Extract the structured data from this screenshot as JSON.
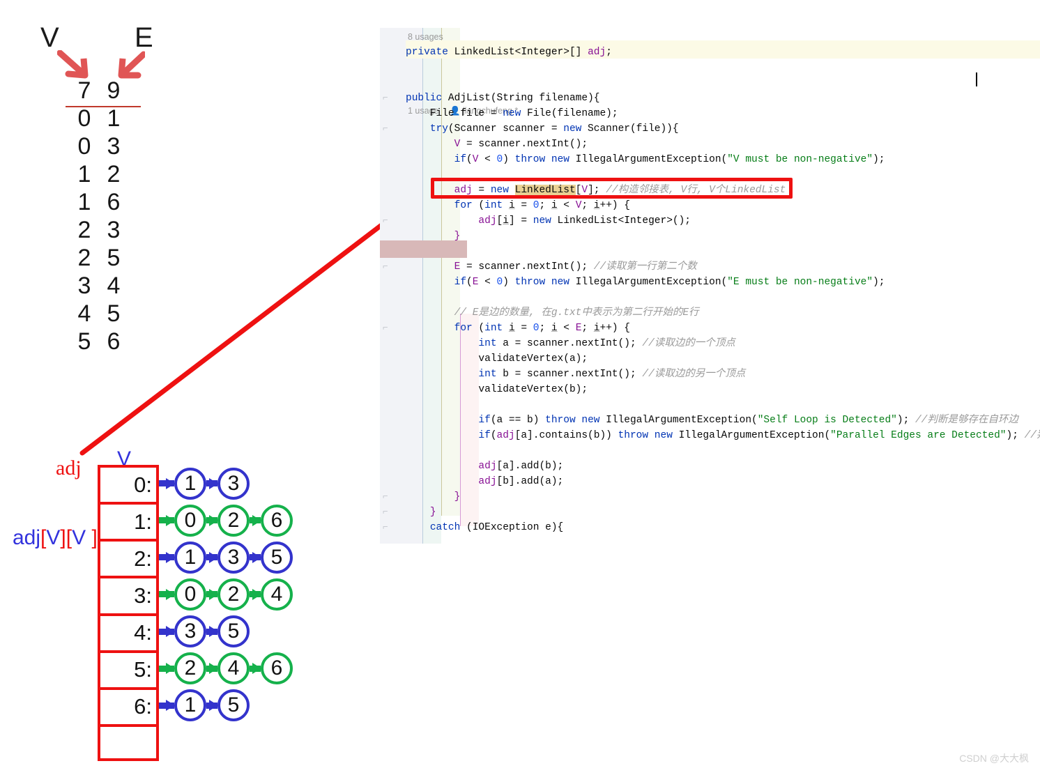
{
  "ve_diagram": {
    "header_v": "V",
    "header_e": "E",
    "first_row": [
      "7",
      "9"
    ],
    "edges": [
      [
        "0",
        "1"
      ],
      [
        "0",
        "3"
      ],
      [
        "1",
        "2"
      ],
      [
        "1",
        "6"
      ],
      [
        "2",
        "3"
      ],
      [
        "2",
        "5"
      ],
      [
        "3",
        "4"
      ],
      [
        "4",
        "5"
      ],
      [
        "5",
        "6"
      ]
    ]
  },
  "adj_diagram": {
    "pointer_label": "adj",
    "array_label": "adj[V][V ]",
    "column_label": "V",
    "rows": [
      {
        "index": "0:",
        "color": "#3333cc",
        "neighbors": [
          "1",
          "3"
        ]
      },
      {
        "index": "1:",
        "color": "#15b14b",
        "neighbors": [
          "0",
          "2",
          "6"
        ]
      },
      {
        "index": "2:",
        "color": "#3333cc",
        "neighbors": [
          "1",
          "3",
          "5"
        ]
      },
      {
        "index": "3:",
        "color": "#15b14b",
        "neighbors": [
          "0",
          "2",
          "4"
        ]
      },
      {
        "index": "4:",
        "color": "#3333cc",
        "neighbors": [
          "3",
          "5"
        ]
      },
      {
        "index": "5:",
        "color": "#15b14b",
        "neighbors": [
          "2",
          "4",
          "6"
        ]
      },
      {
        "index": "6:",
        "color": "#3333cc",
        "neighbors": [
          "1",
          "5"
        ]
      },
      {
        "index": "",
        "color": "#3333cc",
        "neighbors": []
      }
    ]
  },
  "editor": {
    "usages_field": "8 usages",
    "usages_method": "1 usage",
    "author": "jiangchufeng *",
    "lines": [
      "private LinkedList<Integer>[] adj;",
      "public AdjList(String filename){",
      "    File file = new File(filename);",
      "    try(Scanner scanner = new Scanner(file)){",
      "        V = scanner.nextInt();",
      "        if(V < 0) throw new IllegalArgumentException(\"V must be non-negative\");",
      "        adj = new LinkedList[V]; //构造邻接表, V行, V个LinkedList",
      "        for (int i = 0; i < V; i++) {",
      "            adj[i] = new LinkedList<Integer>();",
      "        }",
      "        E = scanner.nextInt(); //读取第一行第二个数",
      "        if(E < 0) throw new IllegalArgumentException(\"E must be non-negative\");",
      "        // E是边的数量, 在g.txt中表示为第二行开始的E行",
      "        for (int i = 0; i < E; i++) {",
      "            int a = scanner.nextInt(); //读取边的一个顶点",
      "            validateVertex(a);",
      "            int b = scanner.nextInt(); //读取边的另一个顶点",
      "            validateVertex(b);",
      "            if(a == b) throw new IllegalArgumentException(\"Self Loop is Detected\"); //判断是够存在自环边",
      "            if(adj[a].contains(b)) throw new IllegalArgumentException(\"Parallel Edges are Detected\"); //判断是够",
      "            adj[a].add(b);",
      "            adj[b].add(a);",
      "        }",
      "    }",
      "    catch (IOException e){"
    ],
    "highlighted_token": "LinkedList",
    "highlight_color": "#e9d194",
    "annotation_box_color": "#ee1111"
  },
  "watermark": "CSDN @大大枫"
}
